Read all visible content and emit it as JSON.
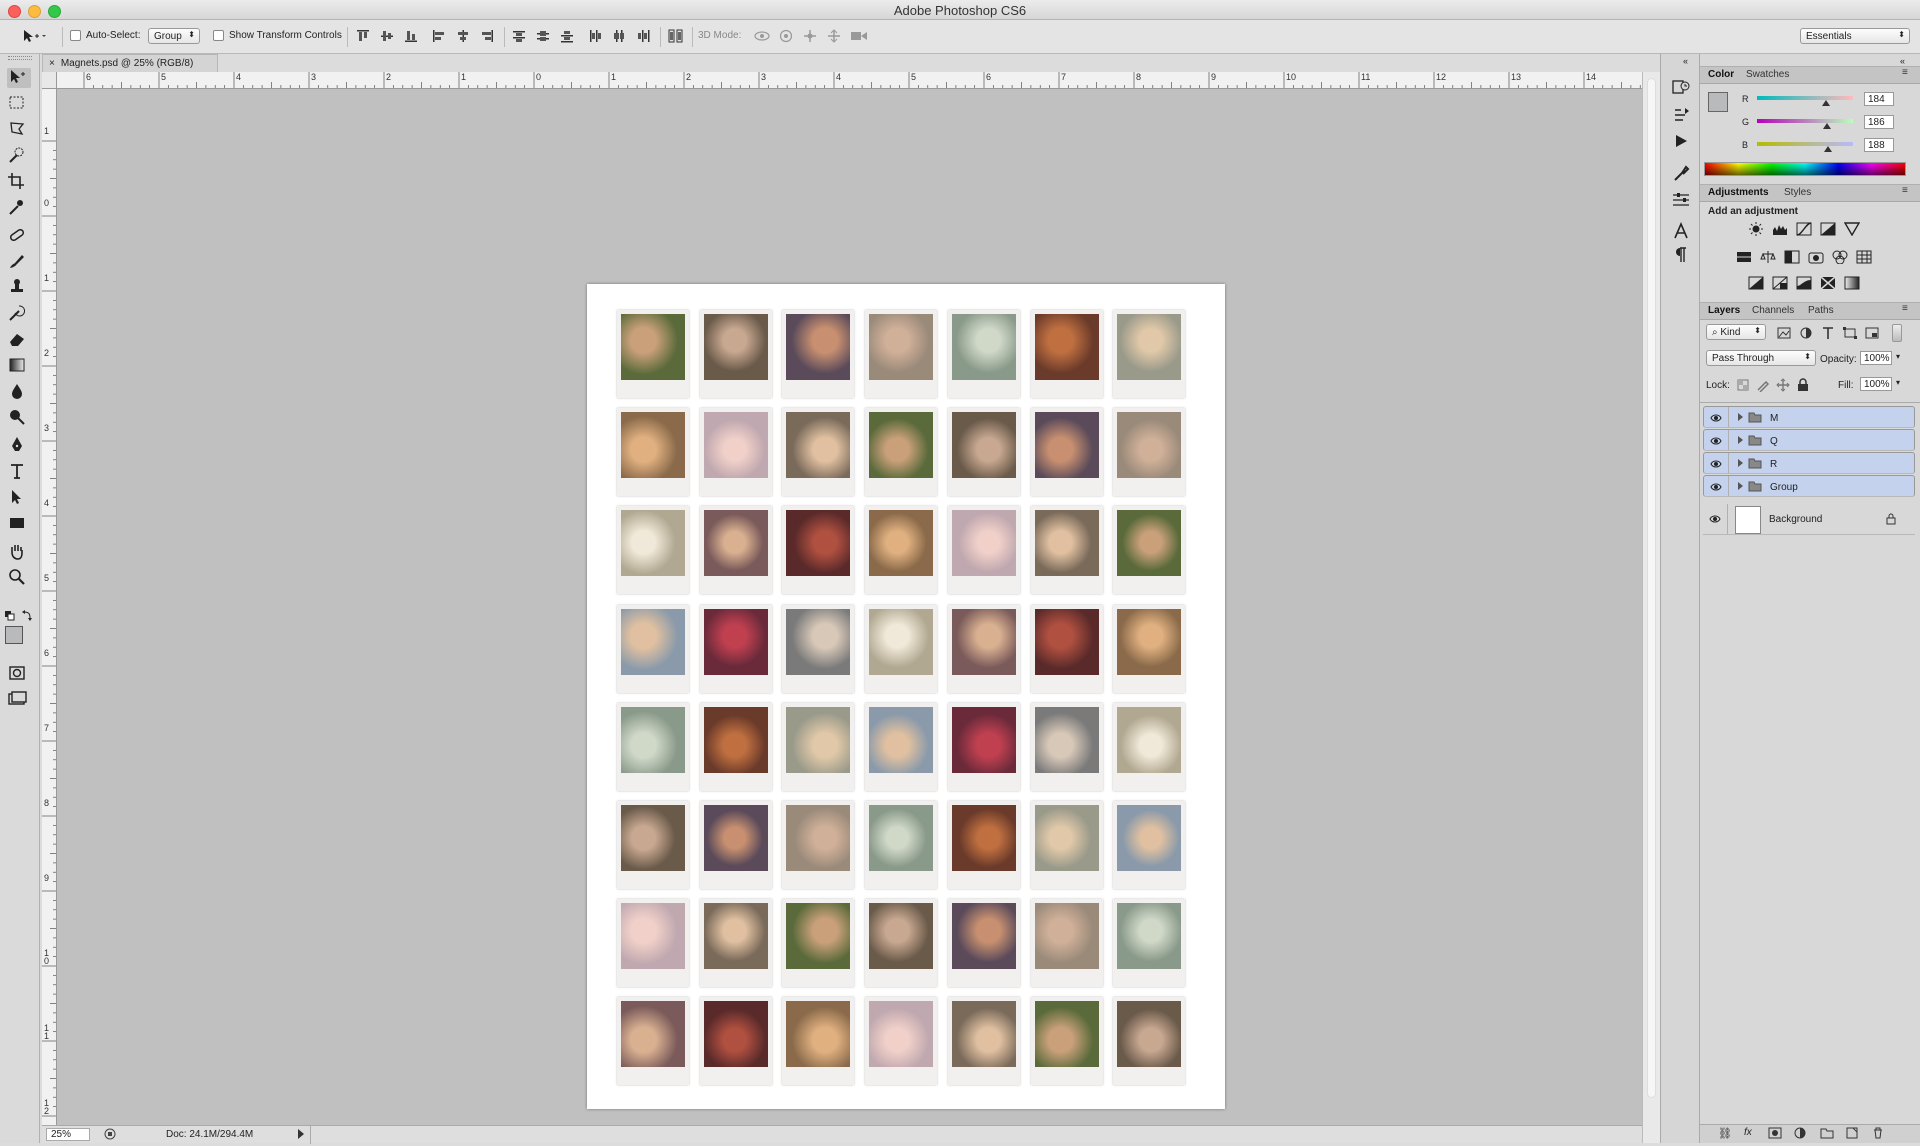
{
  "app": {
    "title": "Adobe Photoshop CS6"
  },
  "options_bar": {
    "auto_select_label": "Auto-Select:",
    "auto_select_value": "Group",
    "show_transform_label": "Show Transform Controls",
    "mode_3d_label": "3D Mode:",
    "workspace": "Essentials"
  },
  "document": {
    "tab_title": "Magnets.psd @ 25% (RGB/8)"
  },
  "rulers": {
    "horizontal": [
      "6",
      "5",
      "4",
      "3",
      "2",
      "1",
      "0",
      "1",
      "2",
      "3",
      "4",
      "5",
      "6",
      "7",
      "8",
      "9",
      "10",
      "11",
      "12",
      "13",
      "14"
    ],
    "vertical": [
      "1",
      "0",
      "1",
      "2",
      "3",
      "4",
      "5",
      "6",
      "7",
      "8",
      "9",
      "1\n0",
      "1\n1",
      "1\n2"
    ]
  },
  "status": {
    "zoom": "25%",
    "doc_info": "Doc: 24.1M/294.4M"
  },
  "color_panel": {
    "tabs": [
      "Color",
      "Swatches"
    ],
    "r_label": "R",
    "g_label": "G",
    "b_label": "B",
    "r": "184",
    "g": "186",
    "b": "188",
    "r_level": 0.72,
    "g_level": 0.73,
    "b_level": 0.74
  },
  "adjustments_panel": {
    "tabs": [
      "Adjustments",
      "Styles"
    ],
    "heading": "Add an adjustment"
  },
  "layers_panel": {
    "tabs": [
      "Layers",
      "Channels",
      "Paths"
    ],
    "filter_kind": "Kind",
    "blend_mode": "Pass Through",
    "opacity_label": "Opacity:",
    "opacity": "100%",
    "lock_label": "Lock:",
    "fill_label": "Fill:",
    "fill": "100%",
    "layers": [
      {
        "name": "M",
        "type": "group",
        "selected": true
      },
      {
        "name": "Q",
        "type": "group",
        "selected": true
      },
      {
        "name": "R",
        "type": "group",
        "selected": true
      },
      {
        "name": "Group",
        "type": "group",
        "selected": true
      },
      {
        "name": "Background",
        "type": "pixel",
        "selected": false
      }
    ]
  },
  "colors": {
    "foreground": "#b8babc",
    "selection": "#c4d2ee",
    "workspace": "#c0c0c0"
  },
  "photo_grid": {
    "rows": 8,
    "cols": 7
  }
}
